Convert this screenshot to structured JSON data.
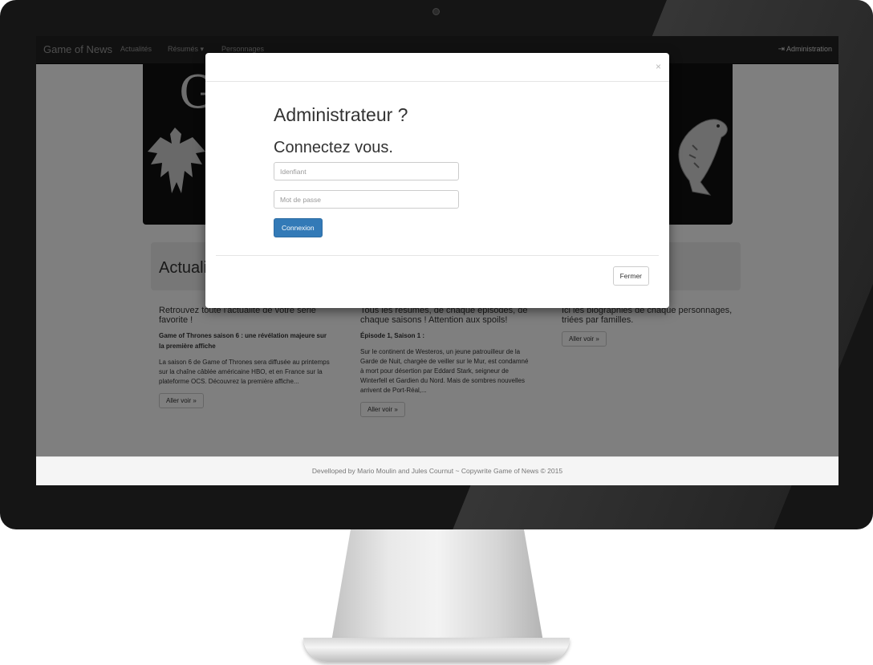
{
  "navbar": {
    "brand": "Game of News",
    "links": [
      "Actualités",
      "Résumés",
      "Personnages"
    ],
    "dropdown_caret": "▾",
    "admin_icon": "login-icon",
    "admin_label": "Administration"
  },
  "jumbotron": {
    "letter": "G"
  },
  "section": {
    "title": "Actualités"
  },
  "columns": [
    {
      "heading": "Retrouvez toute l'actualité de votre série favorite !",
      "subheading": "Game of Thrones saison 6 : une révélation majeure sur la première affiche",
      "text": "La saison 6 de Game of Thrones sera diffusée au printemps sur la chaîne câblée américaine HBO, et en France sur la plateforme OCS. Découvrez la première affiche...",
      "button": "Aller voir »"
    },
    {
      "heading": "Tous les résumés, de chaque épisodes, de chaque saisons ! Attention aux spoils!",
      "subheading": "Épisode 1, Saison 1 :",
      "text": "Sur le continent de Westeros, un jeune patrouilleur de la Garde de Nuit, chargée de veiller sur le Mur, est condamné à mort pour désertion par Eddard Stark, seigneur de Winterfell et Gardien du Nord. Mais de sombres nouvelles arrivent de Port-Réal,...",
      "button": "Aller voir »"
    },
    {
      "heading": "Ici les biographies de chaque personnages, triées par familles.",
      "button": "Aller voir »"
    }
  ],
  "footer": {
    "text": "Develloped by Mario Moulin and Jules Cournut ~ Copywrite Game of News © 2015"
  },
  "modal": {
    "close_symbol": "×",
    "title": "Administrateur ?",
    "subtitle": "Connectez vous.",
    "username_placeholder": "Idenfiant",
    "password_placeholder": "Mot de passe",
    "submit_label": "Connexion",
    "close_label": "Fermer"
  }
}
